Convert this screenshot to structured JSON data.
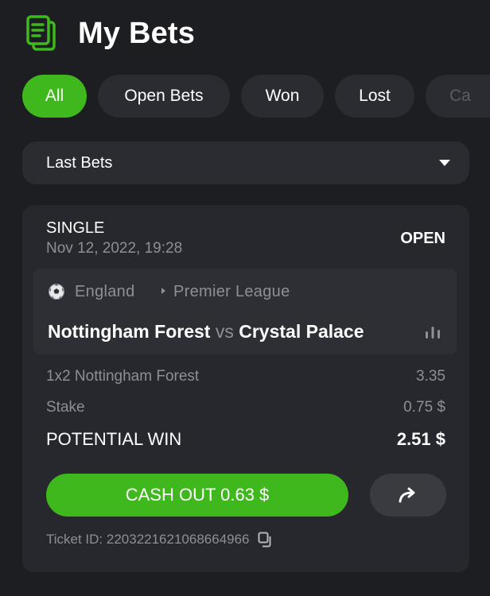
{
  "header": {
    "title": "My Bets",
    "icon": "bets-document-icon",
    "accent": "#3fb81d"
  },
  "filters": {
    "items": [
      {
        "label": "All",
        "active": true
      },
      {
        "label": "Open Bets",
        "active": false
      },
      {
        "label": "Won",
        "active": false
      },
      {
        "label": "Lost",
        "active": false
      },
      {
        "label": "Ca",
        "active": false
      }
    ]
  },
  "period_select": {
    "value": "Last Bets"
  },
  "bet": {
    "type": "SINGLE",
    "date": "Nov 12, 2022, 19:28",
    "status": "OPEN",
    "event": {
      "sport_icon": "soccer-ball-icon",
      "country": "England",
      "league": "Premier League",
      "home": "Nottingham Forest",
      "vs": "vs",
      "away": "Crystal Palace"
    },
    "selection": {
      "label": "1x2 Nottingham Forest",
      "odds": "3.35"
    },
    "stake": {
      "label": "Stake",
      "value": "0.75 $"
    },
    "potential_win": {
      "label": "POTENTIAL WIN",
      "value": "2.51 $"
    },
    "cashout_label": "CASH OUT 0.63 $",
    "ticket_id": "Ticket ID: 2203221621068664966"
  }
}
